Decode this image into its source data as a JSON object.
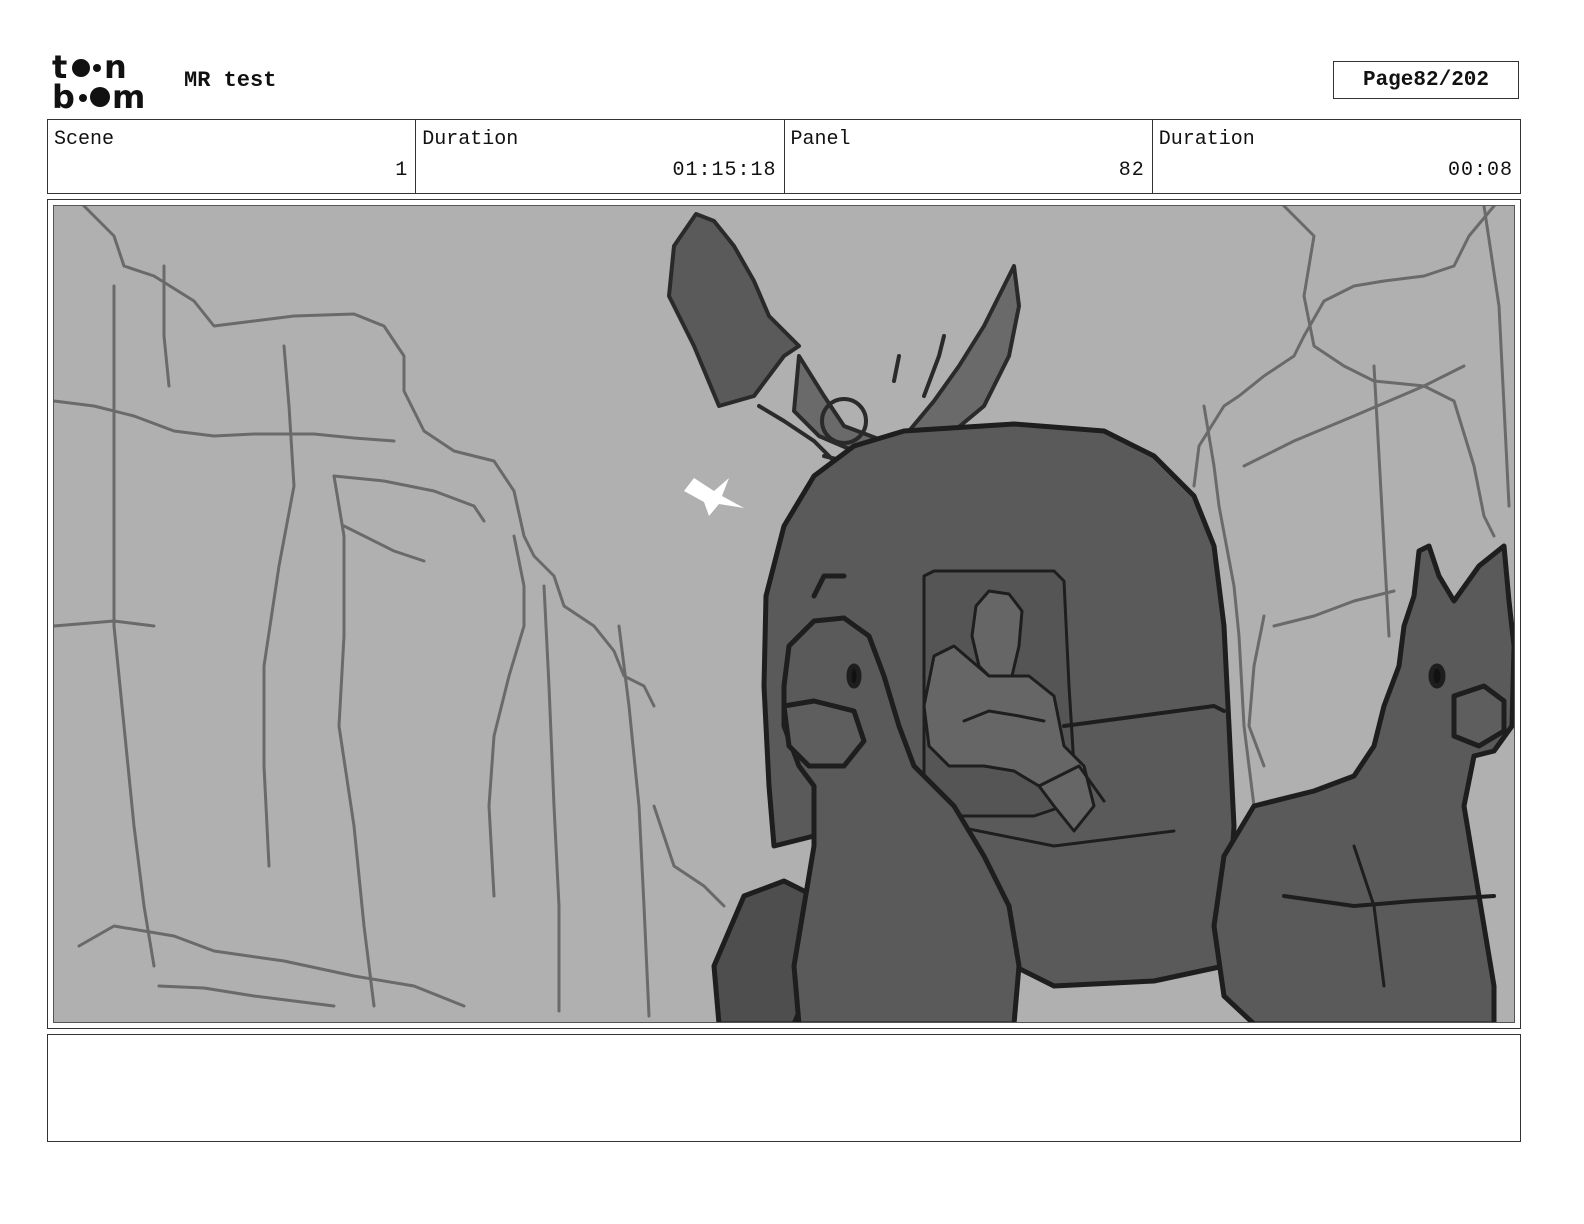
{
  "header": {
    "logo_line1": "t••n",
    "logo_line2": "b••m",
    "project_title": "MR test",
    "page_label": "Page",
    "page_value": "82/202"
  },
  "info": [
    {
      "label": "Scene",
      "value": "1"
    },
    {
      "label": "Duration",
      "value": "01:15:18"
    },
    {
      "label": "Panel",
      "value": "82"
    },
    {
      "label": "Duration",
      "value": "00:08"
    }
  ],
  "panel": {
    "background_color": "#b0b0b0",
    "fill_dark": "#5a5a5a",
    "line_color": "#2a2a2a",
    "sketch_line_color": "#666666"
  },
  "notes": {
    "text": ""
  }
}
